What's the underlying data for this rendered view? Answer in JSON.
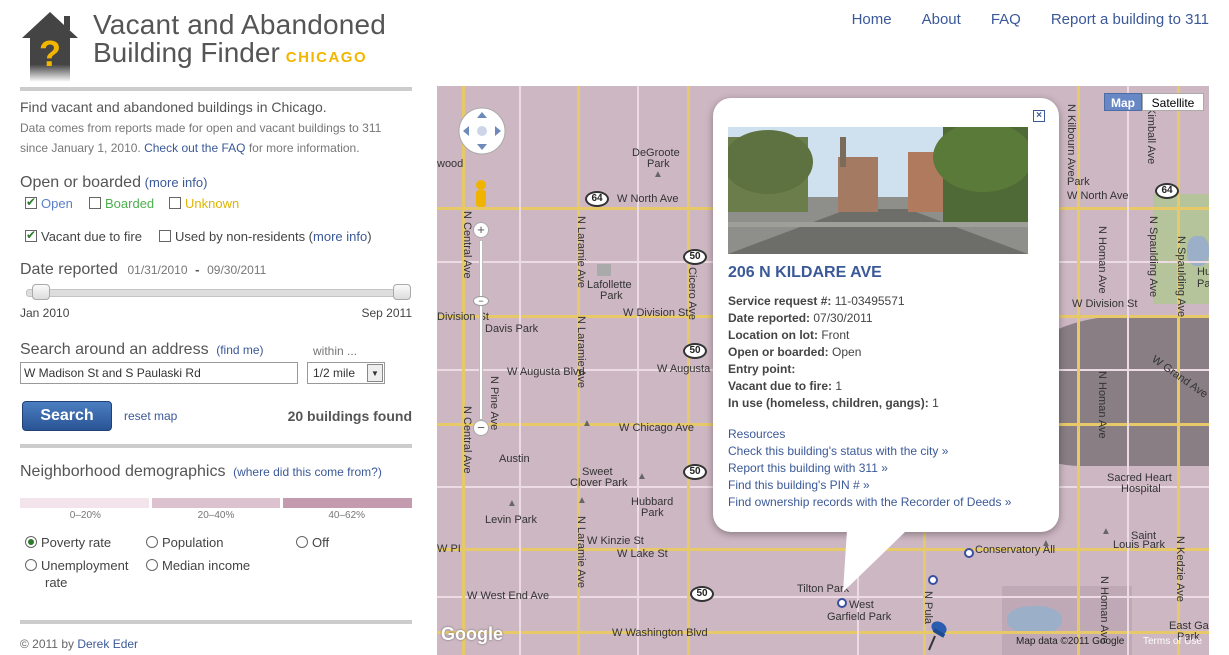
{
  "header": {
    "title_line1": "Vacant and Abandoned",
    "title_line2": "Building Finder",
    "city": "CHICAGO",
    "nav": [
      "Home",
      "About",
      "FAQ",
      "Report a building to 311"
    ]
  },
  "intro": {
    "headline": "Find vacant and abandoned buildings in Chicago.",
    "line1": "Data comes from reports made for open and vacant buildings to 311",
    "line2_prefix": "since January 1, 2010.",
    "faq_link": "Check out the FAQ",
    "line2_suffix": "for more information."
  },
  "filters": {
    "open_boarded_title": "Open or boarded",
    "more_info": "(more info)",
    "open": "Open",
    "boarded": "Boarded",
    "unknown": "Unknown",
    "vacant_fire": "Vacant due to fire",
    "non_residents": "Used by non-residents (",
    "more_info2": "more info",
    "close_paren": ")"
  },
  "date": {
    "title": "Date reported",
    "from": "01/31/2010",
    "dash": "-",
    "to": "09/30/2011",
    "min_label": "Jan 2010",
    "max_label": "Sep 2011"
  },
  "search": {
    "title": "Search around an address",
    "find_me": "(find me)",
    "within": "within ...",
    "address_value": "W Madison St and S Paulaski Rd",
    "radius": "1/2 mile",
    "button": "Search",
    "reset": "reset map",
    "found": "20 buildings found"
  },
  "demographics": {
    "title": "Neighborhood demographics",
    "source_link": "(where did this come from?)",
    "legend": [
      {
        "label": "0–20%",
        "color": "#f3e3ea"
      },
      {
        "label": "20–40%",
        "color": "#dcc1cf"
      },
      {
        "label": "40–62%",
        "color": "#c49aaf"
      }
    ],
    "options": {
      "poverty": "Poverty rate",
      "population": "Population",
      "off": "Off",
      "unemployment_1": "Unemployment",
      "unemployment_2": "rate",
      "median_income": "Median income"
    }
  },
  "footer": {
    "copyright": "© 2011 by",
    "author": "Derek Eder"
  },
  "map": {
    "type_map": "Map",
    "type_satellite": "Satellite",
    "attribution": "Map data ©2011 Google",
    "terms": "Terms of Use",
    "google": "Google",
    "labels": {
      "degrogate": "DeGroote",
      "park1": "Park",
      "w_north_ave": "W North Ave",
      "w_north_ave2": "W North Ave",
      "lafollette": "Lafollette",
      "park2": "Park",
      "davis_park": "Davis Park",
      "w_division_st": "W Division St",
      "division_st": "Division St",
      "w_division_st2": "W Division St",
      "w_augusta": "W Augusta Blvd",
      "w_augusta2": "W Augusta Blvd",
      "w_chicago": "W Chicago Ave",
      "austin": "Austin",
      "sweet": "Sweet",
      "clover": "Clover Park",
      "hubbard": "Hubbard",
      "park3": "Park",
      "levin": "Levin Park",
      "w_kinzie": "W Kinzie St",
      "w_lake": "W Lake St",
      "w_pl": "W PI",
      "w_west_end": "W West End Ave",
      "tilton": "Tilton Park",
      "west_garfield1": "West",
      "west_garfield2": "Garfield Park",
      "w_washington": "W Washington Blvd",
      "wood": "wood",
      "park_top": "Park",
      "humboldt": "Humb",
      "humboldt2": "Pa",
      "w_grand": "W Grand Ave",
      "sacred_heart1": "Sacred Heart",
      "sacred_heart2": "Hospital",
      "saint_louis1": "Saint",
      "saint_louis2": "Louis Park",
      "conservatory": "Conservatory All",
      "east_ga1": "East Ga",
      "east_ga2": "Park",
      "n_central": "N Central Ave",
      "n_laramie": "N Laramie Ave",
      "n_cicero": "N Cicero Ave",
      "n_kilbourn": "N Kilbourn Ave",
      "n_homan": "N Homan Ave",
      "n_spaulding": "N Spaulding Ave",
      "n_kimball": "N Kimball Ave",
      "n_kedzie": "N Kedzie Ave",
      "n_pulaski": "N Pula",
      "n_pine": "N Pine Ave",
      "s_laramie": "N Laramie Ave",
      "s_central": "N Central Ave"
    },
    "shields": [
      "64",
      "64",
      "50",
      "50",
      "50",
      "50",
      "64"
    ]
  },
  "popup": {
    "address": "206 N KILDARE AVE",
    "fields": [
      {
        "k": "Service request #:",
        "v": "11-03495571"
      },
      {
        "k": "Date reported:",
        "v": "07/30/2011"
      },
      {
        "k": "Location on lot:",
        "v": "Front"
      },
      {
        "k": "Open or boarded:",
        "v": "Open"
      },
      {
        "k": "Entry point:",
        "v": ""
      },
      {
        "k": "Vacant due to fire:",
        "v": "1"
      },
      {
        "k": "In use (homeless, children, gangs):",
        "v": "1"
      }
    ],
    "resources_title": "Resources",
    "links": [
      "Check this building's status with the city »",
      "Report this building with 311 »",
      "Find this building's PIN # »",
      "Find ownership records with the Recorder of Deeds »"
    ]
  },
  "colors": {
    "link": "#3b5998",
    "accent": "#f2b600",
    "map_bg": "#cdb7c2",
    "button": "#2f5f9e"
  }
}
